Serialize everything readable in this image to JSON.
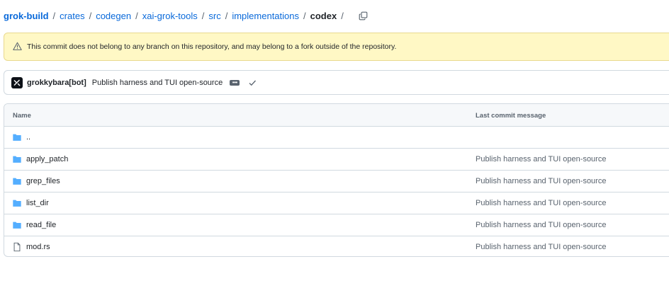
{
  "breadcrumb": {
    "root": "grok-build",
    "parts": [
      "crates",
      "codegen",
      "xai-grok-tools",
      "src",
      "implementations"
    ],
    "current": "codex",
    "separator": "/",
    "copy_icon": "copy-icon"
  },
  "warning": {
    "icon": "alert-icon",
    "text": "This commit does not belong to any branch on this repository, and may belong to a fork outside of the repository."
  },
  "commit": {
    "author": "grokkybara[bot]",
    "message": "Publish harness and TUI open-source",
    "ellipsis": "•••",
    "status_icon": "check-icon"
  },
  "table": {
    "headers": {
      "name": "Name",
      "last_commit": "Last commit message"
    },
    "rows": [
      {
        "type": "folder",
        "name": "..",
        "message": ""
      },
      {
        "type": "folder",
        "name": "apply_patch",
        "message": "Publish harness and TUI open-source"
      },
      {
        "type": "folder",
        "name": "grep_files",
        "message": "Publish harness and TUI open-source"
      },
      {
        "type": "folder",
        "name": "list_dir",
        "message": "Publish harness and TUI open-source"
      },
      {
        "type": "folder",
        "name": "read_file",
        "message": "Publish harness and TUI open-source"
      },
      {
        "type": "file",
        "name": "mod.rs",
        "message": "Publish harness and TUI open-source"
      }
    ]
  },
  "colors": {
    "link": "#0969da",
    "folder": "#54aeff",
    "warning_bg": "#fff8c5",
    "border": "#d1d9e0"
  }
}
